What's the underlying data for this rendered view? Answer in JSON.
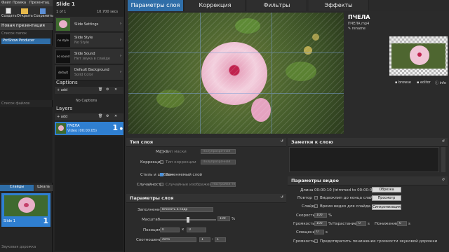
{
  "menubar": {
    "file": "Файл",
    "edit": "Правка",
    "presentation": "Презентац"
  },
  "toolbar": {
    "create": "Создать",
    "open": "Открыть",
    "save": "Сохранить"
  },
  "left": {
    "new_presentation": "Новая презентация",
    "folder_list": "Список папок",
    "folder_item": "ProShow Producer",
    "file_list": "Список файлов",
    "tabs": {
      "slides": "Слайды",
      "timeline": "Шкала"
    },
    "slide_label": "Slide 1",
    "audio_track": "Звуковая дорожка"
  },
  "slide": {
    "title": "Slide 1",
    "counter": "1 of 1",
    "time": "10.700 secs",
    "settings": [
      {
        "name": "Slide Settings",
        "sub": ""
      },
      {
        "name": "Slide Style",
        "sub": "No Style",
        "thumb": "no style"
      },
      {
        "name": "Slide Sound",
        "sub": "Нет звука в слайде",
        "thumb": "no sound"
      },
      {
        "name": "Default Background",
        "sub": "Solid Color",
        "thumb": "default"
      }
    ],
    "captions_title": "Captions",
    "captions_add": "add",
    "no_captions": "No Captions",
    "layers_title": "Layers",
    "layers_add": "add",
    "layer": {
      "name": "ПЧЕЛА",
      "sub": "Video (00:00:05)",
      "num": "1"
    }
  },
  "main_tabs": [
    "Параметры слоя",
    "Коррекция",
    "Фильтры",
    "Эффекты"
  ],
  "preview": {
    "title": "ПЧЕЛА",
    "file": "ПЧЕЛА.mp4",
    "rename": "rename",
    "browse": "browse",
    "editor": "editor",
    "info": "info"
  },
  "layer_type": {
    "title": "Тип слоя",
    "mask_label": "Маска",
    "mask_check": "Тип маски",
    "mask_value": "Полупрозрачная",
    "corr_label": "Коррекция",
    "corr_check": "Тип коррекции",
    "corr_value": "Полупрозрачная",
    "style_label": "Стиль и шаблон",
    "style_check": "Заменяемый слой",
    "random_label": "Случайность",
    "random_check": "Случайные изображения",
    "random_btn": "Настройки тем"
  },
  "layer_params": {
    "title": "Параметры слоя",
    "fill_label": "Заполнение",
    "fill_value": "Вписать в кадр",
    "scale_label": "Масштаб",
    "scale_value": "100",
    "scale_unit": "%",
    "pos_label": "Позиция",
    "pos_x": "0",
    "pos_y": "0",
    "ratio_label": "Соотношение",
    "ratio_value": "Авто",
    "ratio_a": "1",
    "ratio_b": "1"
  },
  "notes": {
    "title": "Заметки к слою"
  },
  "video": {
    "title": "Параметры видео",
    "length_label": "Длина",
    "length_value": "00:00:10 (trimmed to 00:00:05)",
    "trim_btn": "Обрезка",
    "repeat_label": "Повтор",
    "repeat_check": "Видеоклип до конца слайда",
    "preview_btn": "Просмотр",
    "slide_label": "Слайд",
    "slide_check": "Время видео для слайда",
    "sync_btn": "Синхронизация",
    "speed_label": "Скорость",
    "speed_value": "100",
    "volume_label": "Громкость",
    "volume_value": "100",
    "fadein_label": "Нарастание",
    "fadein_value": "0",
    "fadeout_label": "Понижение",
    "fadeout_value": "0",
    "offset_label": "Смещение",
    "offset_value": "0",
    "loud_label": "Громкость",
    "loud_check": "Предотвратить понижение громкости звуковой дорожки",
    "percent": "%",
    "secs": "s"
  },
  "colors": {
    "accent": "#2f6ea8",
    "layer_sel": "#2f7fd1",
    "panel": "#2b2b2b"
  }
}
